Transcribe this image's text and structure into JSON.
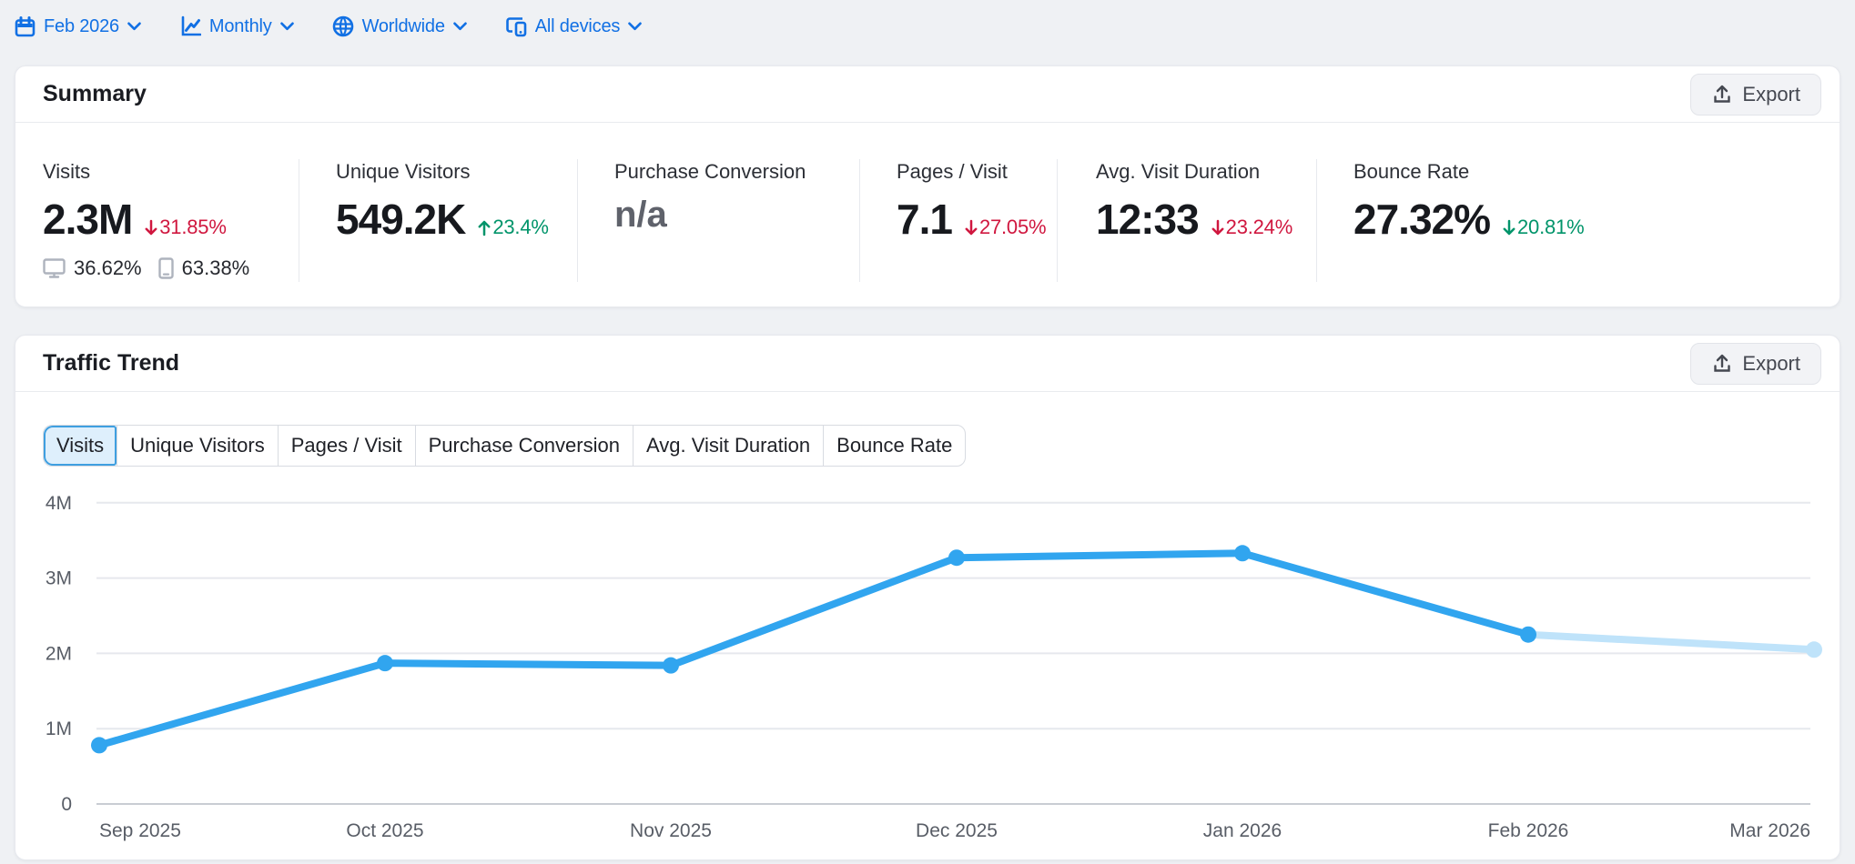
{
  "filters": [
    {
      "label": "Feb 2026",
      "icon": "calendar-icon"
    },
    {
      "label": "Monthly",
      "icon": "chart-line-icon"
    },
    {
      "label": "Worldwide",
      "icon": "globe-icon"
    },
    {
      "label": "All devices",
      "icon": "devices-icon"
    }
  ],
  "summary": {
    "title": "Summary",
    "export_label": "Export",
    "metrics": [
      {
        "label": "Visits",
        "value": "2.3M",
        "delta": "31.85%",
        "direction": "down",
        "sentiment": "bad",
        "desktop_share": "36.62%",
        "mobile_share": "63.38%"
      },
      {
        "label": "Unique Visitors",
        "value": "549.2K",
        "delta": "23.4%",
        "direction": "up",
        "sentiment": "good"
      },
      {
        "label": "Purchase Conversion",
        "value": "n/a"
      },
      {
        "label": "Pages / Visit",
        "value": "7.1",
        "delta": "27.05%",
        "direction": "down",
        "sentiment": "bad"
      },
      {
        "label": "Avg. Visit Duration",
        "value": "12:33",
        "delta": "23.24%",
        "direction": "down",
        "sentiment": "bad"
      },
      {
        "label": "Bounce Rate",
        "value": "27.32%",
        "delta": "20.81%",
        "direction": "down",
        "sentiment": "good"
      }
    ]
  },
  "traffic_trend": {
    "title": "Traffic Trend",
    "export_label": "Export",
    "tabs": [
      {
        "label": "Visits",
        "selected": true
      },
      {
        "label": "Unique Visitors",
        "selected": false
      },
      {
        "label": "Pages / Visit",
        "selected": false
      },
      {
        "label": "Purchase Conversion",
        "selected": false
      },
      {
        "label": "Avg. Visit Duration",
        "selected": false
      },
      {
        "label": "Bounce Rate",
        "selected": false
      }
    ]
  },
  "chart_data": {
    "type": "line",
    "title": "Traffic Trend - Visits",
    "categories": [
      "Sep 2025",
      "Oct 2025",
      "Nov 2025",
      "Dec 2025",
      "Jan 2026",
      "Feb 2026",
      "Mar 2026"
    ],
    "series": [
      {
        "name": "Visits",
        "values_millions": [
          0.78,
          1.87,
          1.84,
          3.27,
          3.33,
          2.25,
          2.05
        ]
      }
    ],
    "yticks": [
      "0",
      "1M",
      "2M",
      "3M",
      "4M"
    ],
    "ylim_millions": [
      0,
      4
    ],
    "grid": "horizontal",
    "legend": "none",
    "last_segment_projected": true,
    "line_color": "#31a5ef",
    "projected_color": "#bfe3fa",
    "grid_color": "#e6e8ed",
    "zero_line_color": "#c9cdd3",
    "tick_color": "#585d66"
  }
}
